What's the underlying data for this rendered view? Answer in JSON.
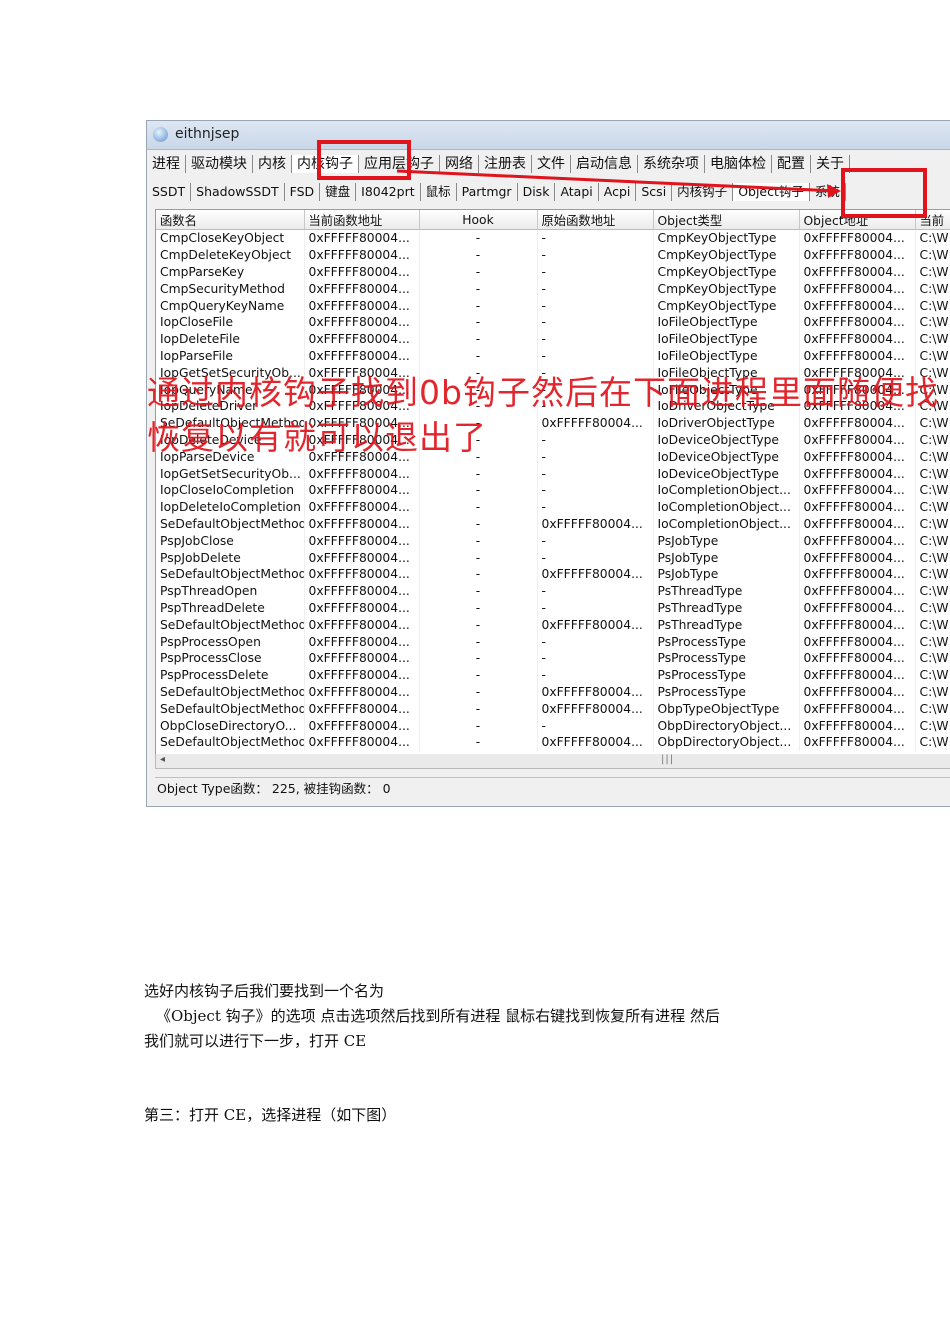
{
  "window": {
    "title": "eithnjsep"
  },
  "tabs_main": [
    "进程",
    "驱动模块",
    "内核",
    "内核钩子",
    "应用层钩子",
    "网络",
    "注册表",
    "文件",
    "启动信息",
    "系统杂项",
    "电脑体检",
    "配置",
    "关于"
  ],
  "tabs_sub": [
    "SSDT",
    "ShadowSSDT",
    "FSD",
    "键盘",
    "I8042prt",
    "鼠标",
    "Partmgr",
    "Disk",
    "Atapi",
    "Acpi",
    "Scsi",
    "内核钩子",
    "Object钩子",
    "系统"
  ],
  "table": {
    "headers": [
      "函数名",
      "当前函数地址",
      "Hook",
      "原始函数地址",
      "Object类型",
      "Object地址",
      "当前"
    ],
    "rows": [
      [
        "CmpCloseKeyObject",
        "0xFFFFF80004...",
        "-",
        "-",
        "CmpKeyObjectType",
        "0xFFFFF80004...",
        "C:\\W"
      ],
      [
        "CmpDeleteKeyObject",
        "0xFFFFF80004...",
        "-",
        "-",
        "CmpKeyObjectType",
        "0xFFFFF80004...",
        "C:\\W"
      ],
      [
        "CmpParseKey",
        "0xFFFFF80004...",
        "-",
        "-",
        "CmpKeyObjectType",
        "0xFFFFF80004...",
        "C:\\W"
      ],
      [
        "CmpSecurityMethod",
        "0xFFFFF80004...",
        "-",
        "-",
        "CmpKeyObjectType",
        "0xFFFFF80004...",
        "C:\\W"
      ],
      [
        "CmpQueryKeyName",
        "0xFFFFF80004...",
        "-",
        "-",
        "CmpKeyObjectType",
        "0xFFFFF80004...",
        "C:\\W"
      ],
      [
        "IopCloseFile",
        "0xFFFFF80004...",
        "-",
        "-",
        "IoFileObjectType",
        "0xFFFFF80004...",
        "C:\\W"
      ],
      [
        "IopDeleteFile",
        "0xFFFFF80004...",
        "-",
        "-",
        "IoFileObjectType",
        "0xFFFFF80004...",
        "C:\\W"
      ],
      [
        "IopParseFile",
        "0xFFFFF80004...",
        "-",
        "-",
        "IoFileObjectType",
        "0xFFFFF80004...",
        "C:\\W"
      ],
      [
        "IopGetSetSecurityOb...",
        "0xFFFFF80004...",
        "-",
        "-",
        "IoFileObjectType",
        "0xFFFFF80004...",
        "C:\\W"
      ],
      [
        "IopQueryName",
        "0xFFFFF80004...",
        "-",
        "-",
        "IoFileObjectType",
        "0xFFFFF80004...",
        "C:\\W"
      ],
      [
        "IopDeleteDriver",
        "0xFFFFF80004...",
        "-",
        "-",
        "IoDriverObjectType",
        "0xFFFFF80004...",
        "C:\\W"
      ],
      [
        "SeDefaultObjectMethod",
        "0xFFFFF80004...",
        "-",
        "0xFFFFF80004...",
        "IoDriverObjectType",
        "0xFFFFF80004...",
        "C:\\W"
      ],
      [
        "IopDeleteDevice",
        "0xFFFFF80004...",
        "-",
        "-",
        "IoDeviceObjectType",
        "0xFFFFF80004...",
        "C:\\W"
      ],
      [
        "IopParseDevice",
        "0xFFFFF80004...",
        "-",
        "-",
        "IoDeviceObjectType",
        "0xFFFFF80004...",
        "C:\\W"
      ],
      [
        "IopGetSetSecurityOb...",
        "0xFFFFF80004...",
        "-",
        "-",
        "IoDeviceObjectType",
        "0xFFFFF80004...",
        "C:\\W"
      ],
      [
        "IopCloseIoCompletion",
        "0xFFFFF80004...",
        "-",
        "-",
        "IoCompletionObject...",
        "0xFFFFF80004...",
        "C:\\W"
      ],
      [
        "IopDeleteIoCompletion",
        "0xFFFFF80004...",
        "-",
        "-",
        "IoCompletionObject...",
        "0xFFFFF80004...",
        "C:\\W"
      ],
      [
        "SeDefaultObjectMethod",
        "0xFFFFF80004...",
        "-",
        "0xFFFFF80004...",
        "IoCompletionObject...",
        "0xFFFFF80004...",
        "C:\\W"
      ],
      [
        "PspJobClose",
        "0xFFFFF80004...",
        "-",
        "-",
        "PsJobType",
        "0xFFFFF80004...",
        "C:\\W"
      ],
      [
        "PspJobDelete",
        "0xFFFFF80004...",
        "-",
        "-",
        "PsJobType",
        "0xFFFFF80004...",
        "C:\\W"
      ],
      [
        "SeDefaultObjectMethod",
        "0xFFFFF80004...",
        "-",
        "0xFFFFF80004...",
        "PsJobType",
        "0xFFFFF80004...",
        "C:\\W"
      ],
      [
        "PspThreadOpen",
        "0xFFFFF80004...",
        "-",
        "-",
        "PsThreadType",
        "0xFFFFF80004...",
        "C:\\W"
      ],
      [
        "PspThreadDelete",
        "0xFFFFF80004...",
        "-",
        "-",
        "PsThreadType",
        "0xFFFFF80004...",
        "C:\\W"
      ],
      [
        "SeDefaultObjectMethod",
        "0xFFFFF80004...",
        "-",
        "0xFFFFF80004...",
        "PsThreadType",
        "0xFFFFF80004...",
        "C:\\W"
      ],
      [
        "PspProcessOpen",
        "0xFFFFF80004...",
        "-",
        "-",
        "PsProcessType",
        "0xFFFFF80004...",
        "C:\\W"
      ],
      [
        "PspProcessClose",
        "0xFFFFF80004...",
        "-",
        "-",
        "PsProcessType",
        "0xFFFFF80004...",
        "C:\\W"
      ],
      [
        "PspProcessDelete",
        "0xFFFFF80004...",
        "-",
        "-",
        "PsProcessType",
        "0xFFFFF80004...",
        "C:\\W"
      ],
      [
        "SeDefaultObjectMethod",
        "0xFFFFF80004...",
        "-",
        "0xFFFFF80004...",
        "PsProcessType",
        "0xFFFFF80004...",
        "C:\\W"
      ],
      [
        "SeDefaultObjectMethod",
        "0xFFFFF80004...",
        "-",
        "0xFFFFF80004...",
        "ObpTypeObjectType",
        "0xFFFFF80004...",
        "C:\\W"
      ],
      [
        "ObpCloseDirectoryO...",
        "0xFFFFF80004...",
        "-",
        "-",
        "ObpDirectoryObject...",
        "0xFFFFF80004...",
        "C:\\W"
      ],
      [
        "SeDefaultObjectMethod",
        "0xFFFFF80004...",
        "-",
        "0xFFFFF80004...",
        "ObpDirectoryObject...",
        "0xFFFFF80004...",
        "C:\\W"
      ]
    ]
  },
  "status": "Object Type函数： 225,  被挂钩函数： 0",
  "annotation": {
    "line1": "通过内核钩子找到0b钩子然后在下面进程里面随便找",
    "line2": "恢复以有就可以退出了"
  },
  "paragraphs": {
    "p1": "选好内核钩子后我们要找到一个名为",
    "p2": "《Object 钩子》的选项    点击选项然后找到所有进程  鼠标右键找到恢复所有进程      然后",
    "p3": "我们就可以进行下一步，打开 CE",
    "p4": "第三：打开 CE，选择进程（如下图）"
  },
  "colors": {
    "highlight": "#e0141c"
  },
  "icons": {
    "app": "app-icon",
    "scroll_left": "scroll-left-icon"
  }
}
